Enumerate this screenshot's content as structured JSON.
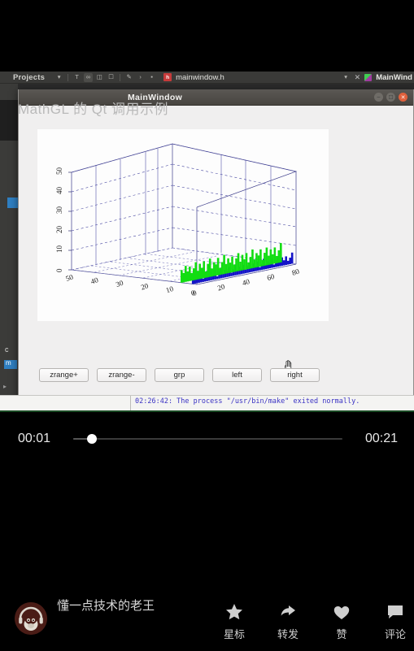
{
  "player": {
    "current_time": "00:01",
    "total_time": "00:21",
    "progress_percent": 7
  },
  "video": {
    "ide": {
      "projects_label": "Projects",
      "file_tab_label": "mainwindow.h",
      "file_badge": "h",
      "right_window_label": "MainWind",
      "close_icon": "close-icon",
      "dropdown_icon": "chevron-down-icon",
      "output_time": "02:26:42",
      "output_message": "02:26:42: The process \"/usr/bin/make\" exited normally.",
      "faint_text": "..."
    },
    "window": {
      "title": "MainWindow",
      "minimize_icon": "minimize-icon",
      "maximize_icon": "maximize-icon",
      "close_icon": "close-icon",
      "buttons": [
        {
          "label": "zrange+",
          "name": "zrange-plus-button"
        },
        {
          "label": "zrange-",
          "name": "zrange-minus-button"
        },
        {
          "label": "grp",
          "name": "grp-button"
        },
        {
          "label": "left",
          "name": "left-button"
        },
        {
          "label": "right",
          "name": "right-button"
        }
      ]
    }
  },
  "chart_data": {
    "type": "bar",
    "title": "",
    "xlabel": "",
    "ylabel": "",
    "zlabel": "",
    "projection": "3d",
    "grid": true,
    "legend_position": "none",
    "axes": {
      "x": {
        "ticks": [
          50,
          40,
          30,
          20,
          10,
          0
        ],
        "range": [
          50,
          0
        ],
        "label": ""
      },
      "y": {
        "ticks": [
          0,
          20,
          40,
          60,
          80
        ],
        "range": [
          0,
          80
        ],
        "label": ""
      },
      "z": {
        "ticks": [
          0,
          10,
          20,
          30,
          40,
          50
        ],
        "range": [
          0,
          50
        ],
        "label": ""
      }
    },
    "series": [
      {
        "name": "green",
        "color": "#12dd12",
        "values": [
          6.5,
          4.8,
          8.2,
          5.1,
          7.4,
          3.9,
          6.1,
          9.0,
          4.4,
          7.8,
          5.5,
          8.6,
          3.2,
          6.9,
          9.4,
          4.1,
          7.1,
          5.8,
          8.9,
          3.6,
          6.3,
          9.8,
          4.9,
          7.6,
          5.2,
          8.1,
          3.8,
          6.7,
          9.2,
          4.6,
          7.9,
          5.4,
          8.4,
          3.4,
          6.0,
          9.6,
          4.2,
          7.3,
          5.9,
          8.8,
          3.1,
          6.6,
          9.1,
          4.7,
          7.7,
          5.0,
          8.3,
          3.7,
          6.4,
          9.9
        ]
      },
      {
        "name": "blue",
        "color": "#1414c8",
        "values": [
          3.2,
          2.1,
          4.6,
          2.8,
          3.9,
          1.7,
          3.4,
          5.2,
          2.3,
          4.1,
          2.9,
          4.8,
          1.4,
          3.6,
          5.4,
          2.0,
          3.8,
          3.0,
          5.0,
          1.8,
          3.3,
          5.6,
          2.5,
          4.0,
          2.7,
          4.5,
          1.9,
          3.5,
          5.1,
          2.4,
          4.2,
          2.6,
          4.7,
          1.6,
          3.1,
          5.5,
          2.2,
          3.7,
          3.0,
          4.9,
          1.5,
          3.4,
          5.3,
          2.4,
          4.3,
          2.6,
          4.4,
          1.9,
          3.3,
          5.7
        ]
      }
    ]
  },
  "meta": {
    "video_title": "MathGL 的 Qt 调用示例",
    "author_name": "懂一点技术的老王",
    "avatar_name": "monkey-headphones-avatar",
    "actions": [
      {
        "label": "星标",
        "icon": "star-icon",
        "name": "star-action"
      },
      {
        "label": "转发",
        "icon": "share-icon",
        "name": "share-action"
      },
      {
        "label": "赞",
        "icon": "heart-icon",
        "name": "like-action"
      },
      {
        "label": "评论",
        "icon": "comment-icon",
        "name": "comment-action"
      }
    ]
  }
}
